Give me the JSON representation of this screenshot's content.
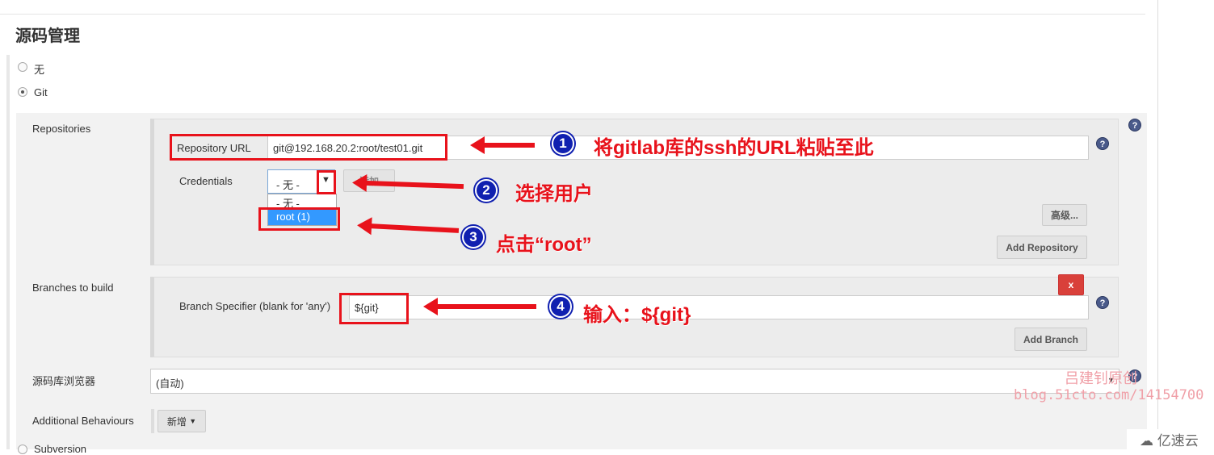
{
  "section_title": "源码管理",
  "scm_options": [
    {
      "label": "无",
      "selected": false
    },
    {
      "label": "Git",
      "selected": true
    },
    {
      "label": "Subversion",
      "selected": false
    }
  ],
  "repositories": {
    "label": "Repositories",
    "url_label": "Repository URL",
    "url_value": "git@192.168.20.2:root/test01.git",
    "credentials_label": "Credentials",
    "credentials_selected": "- 无 -",
    "credentials_options": [
      "- 无 -",
      "root (1)"
    ],
    "add_button": "添加",
    "advanced_button": "高级...",
    "add_repository_button": "Add Repository"
  },
  "branches": {
    "label": "Branches to build",
    "specifier_label": "Branch Specifier (blank for 'any')",
    "specifier_value": "${git}",
    "delete_button": "x",
    "add_branch_button": "Add Branch"
  },
  "browser": {
    "label": "源码库浏览器",
    "value": "(自动)"
  },
  "behaviours": {
    "label": "Additional Behaviours",
    "button": "新增"
  },
  "help": "?",
  "annotations": [
    {
      "num": "1",
      "text": "将gitlab库的ssh的URL粘贴至此"
    },
    {
      "num": "2",
      "text": "选择用户"
    },
    {
      "num": "3",
      "text": "点击“root”"
    },
    {
      "num": "4",
      "text": "输入：${git}"
    }
  ],
  "watermark": {
    "author": "吕建钊原创",
    "url": "blog.51cto.com/14154700",
    "logo": "亿速云"
  },
  "colors": {
    "annotation": "#e8121b",
    "badge": "#1020b0",
    "selected_option": "#3399ff"
  }
}
